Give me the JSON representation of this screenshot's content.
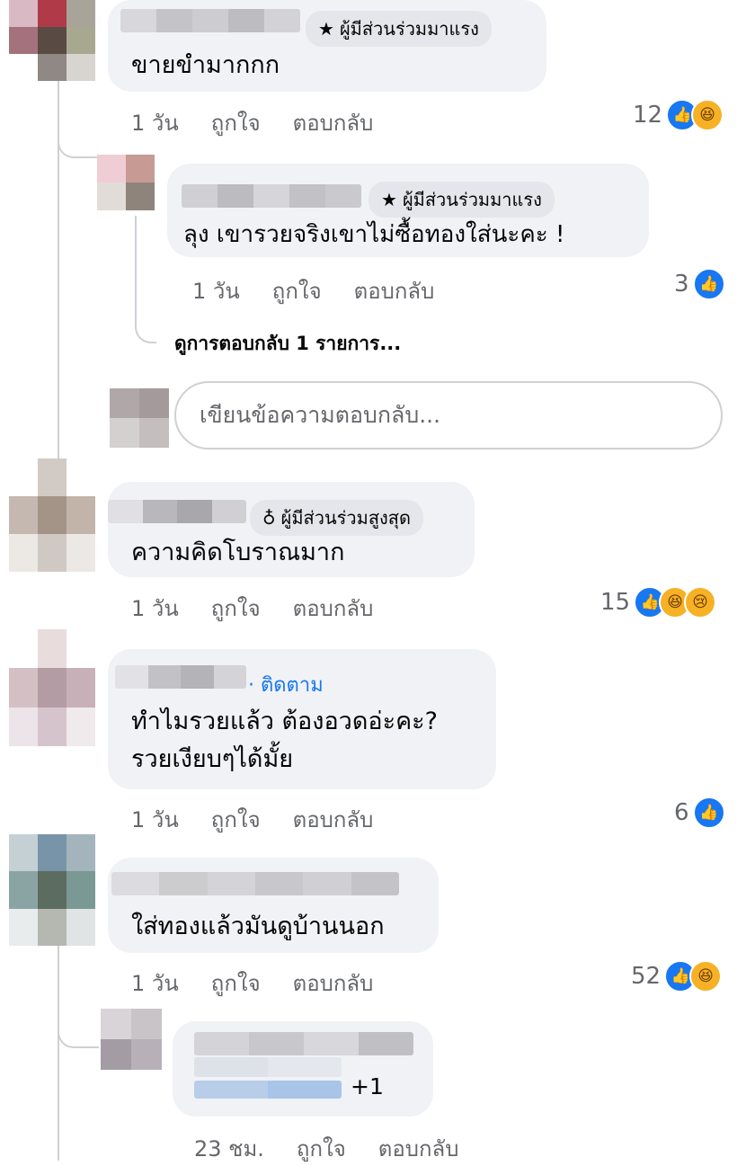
{
  "comments": [
    {
      "badge": "ผู้มีส่วนร่วมมาแรง",
      "text": "ขายขำมากกก",
      "time": "1 วัน",
      "like": "ถูกใจ",
      "reply": "ตอบกลับ",
      "reactions": "12",
      "reaction_icons": [
        "like-icon",
        "haha-icon"
      ]
    },
    {
      "badge": "ผู้มีส่วนร่วมมาแรง",
      "text": "ลุง เขารวยจริงเขาไม่ซื้อทองใส่นะคะ !",
      "time": "1 วัน",
      "like": "ถูกใจ",
      "reply": "ตอบกลับ",
      "reactions": "3",
      "reaction_icons": [
        "like-icon"
      ]
    },
    {
      "badge": "ผู้มีส่วนร่วมสูงสุด",
      "text": "ความคิดโบราณมาก",
      "time": "1 วัน",
      "like": "ถูกใจ",
      "reply": "ตอบกลับ",
      "reactions": "15",
      "reaction_icons": [
        "like-icon",
        "haha-icon",
        "sad-icon"
      ]
    },
    {
      "follow": "· ติดตาม",
      "text_line1": "ทำไมรวยแล้ว ต้องอวดอ่ะคะ?",
      "text_line2": "รวยเงียบๆได้มั้ย",
      "time": "1 วัน",
      "like": "ถูกใจ",
      "reply": "ตอบกลับ",
      "reactions": "6",
      "reaction_icons": [
        "like-icon"
      ]
    },
    {
      "text": "ใส่ทองแล้วมันดูบ้านนอก",
      "time": "1 วัน",
      "like": "ถูกใจ",
      "reply": "ตอบกลับ",
      "reactions": "52",
      "reaction_icons": [
        "like-icon",
        "haha-icon"
      ]
    },
    {
      "extra": "+1",
      "time": "23 ชม.",
      "like": "ถูกใจ",
      "reply": "ตอบกลับ"
    }
  ],
  "view_replies": "ดูการตอบกลับ 1 รายการ...",
  "reply_input": {
    "placeholder": "เขียนข้อความตอบกลับ..."
  },
  "colors": {
    "like": "#1877f2",
    "bubble": "#f0f2f5",
    "meta": "#65676b"
  }
}
